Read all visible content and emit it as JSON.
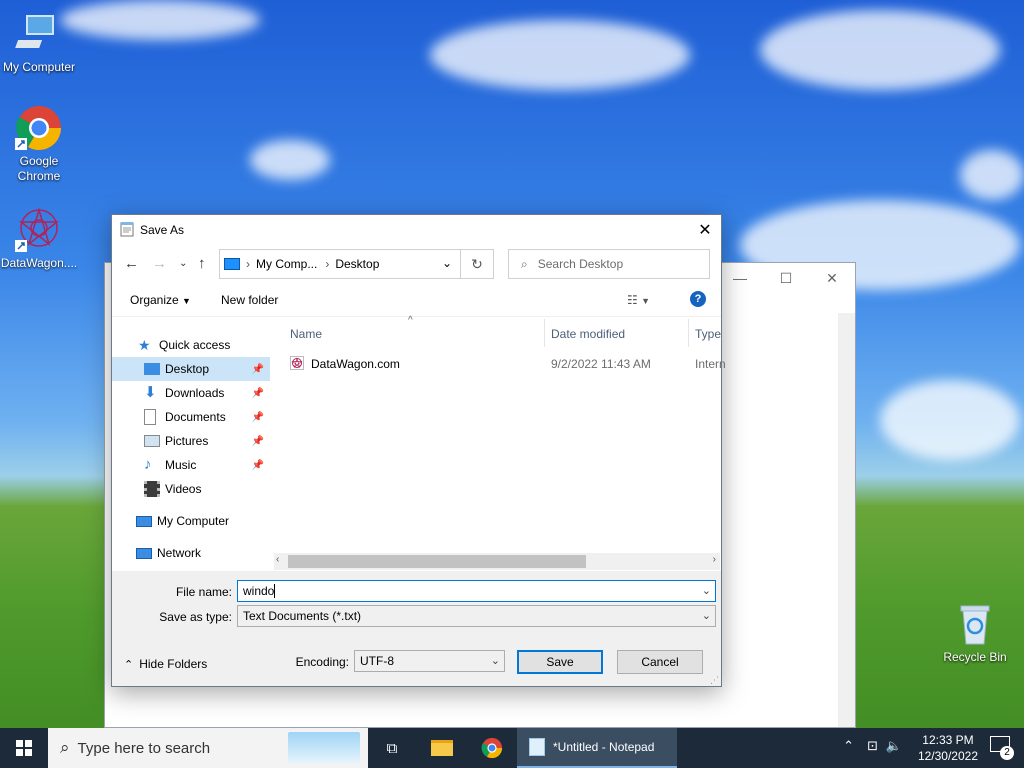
{
  "desktop": {
    "icons": [
      {
        "label": "My Computer"
      },
      {
        "label": "Google Chrome"
      },
      {
        "label": "DataWagon...."
      },
      {
        "label": "Recycle Bin"
      }
    ]
  },
  "notepad": {
    "title": "*Untitled - Notepad"
  },
  "dialog": {
    "title": "Save As",
    "address": {
      "segments": [
        "My Comp...",
        "Desktop"
      ]
    },
    "search_placeholder": "Search Desktop",
    "toolbar": {
      "organize": "Organize",
      "new_folder": "New folder"
    },
    "sidebar": {
      "quick_access": "Quick access",
      "items": [
        {
          "label": "Desktop",
          "pinned": true,
          "selected": true
        },
        {
          "label": "Downloads",
          "pinned": true
        },
        {
          "label": "Documents",
          "pinned": true
        },
        {
          "label": "Pictures",
          "pinned": true
        },
        {
          "label": "Music",
          "pinned": true
        },
        {
          "label": "Videos",
          "pinned": false
        }
      ],
      "my_computer": "My Computer",
      "network": "Network"
    },
    "columns": {
      "name": "Name",
      "date_modified": "Date modified",
      "type": "Type"
    },
    "files": [
      {
        "name": "DataWagon.com",
        "date_modified": "9/2/2022 11:43 AM",
        "type": "Intern"
      }
    ],
    "file_name_label": "File name:",
    "file_name_value": "windo",
    "save_as_type_label": "Save as type:",
    "save_as_type_value": "Text Documents (*.txt)",
    "hide_folders": "Hide Folders",
    "encoding_label": "Encoding:",
    "encoding_value": "UTF-8",
    "save_button": "Save",
    "cancel_button": "Cancel"
  },
  "taskbar": {
    "search_placeholder": "Type here to search",
    "active_app": "*Untitled - Notepad",
    "time": "12:33 PM",
    "date": "12/30/2022",
    "notification_count": "2"
  },
  "colors": {
    "accent": "#0078d7",
    "selection": "#cce4f7",
    "taskbar": "#1c2a3a"
  }
}
